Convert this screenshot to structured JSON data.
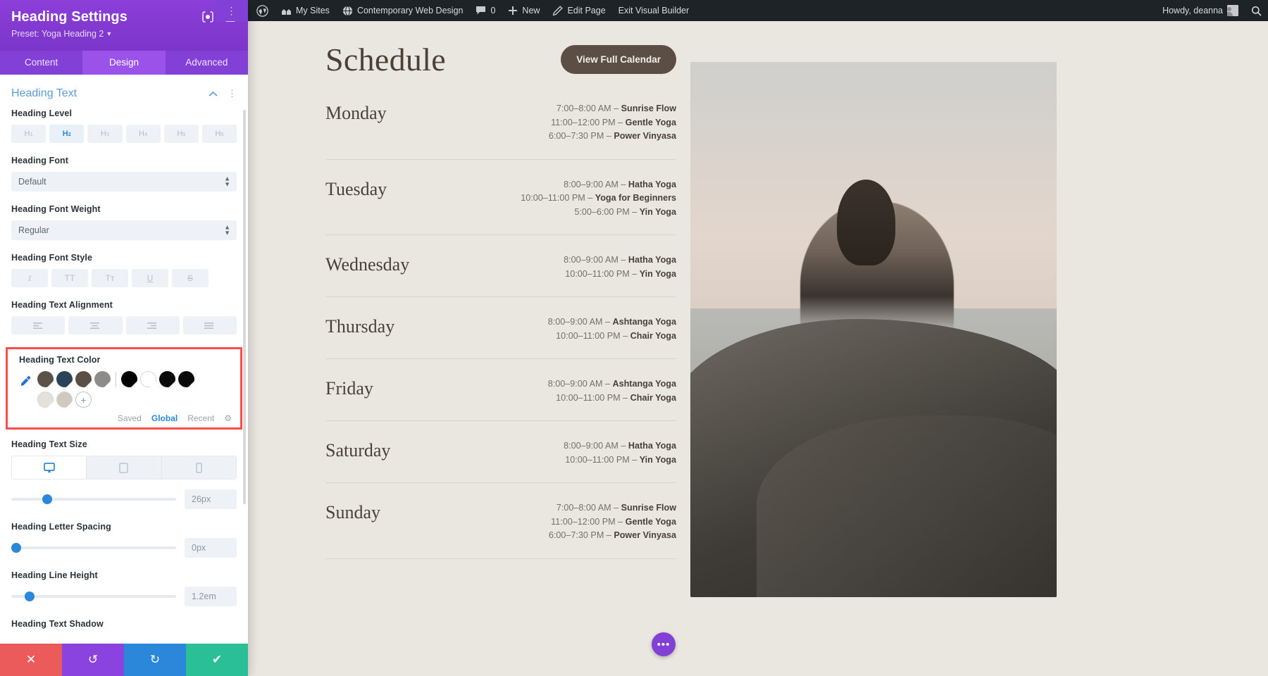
{
  "panel": {
    "title": "Heading Settings",
    "preset": "Preset: Yoga Heading 2",
    "header_icons": [
      "target-icon",
      "layout-icon",
      "more-options-icon"
    ],
    "tabs": [
      {
        "label": "Content",
        "active": false
      },
      {
        "label": "Design",
        "active": true
      },
      {
        "label": "Advanced",
        "active": false
      }
    ],
    "section": {
      "title": "Heading Text",
      "collapse_icon": "chevron-up-icon",
      "menu_icon": "kebab-menu-icon"
    },
    "fields": {
      "heading_level": {
        "label": "Heading Level",
        "options": [
          "H1",
          "H2",
          "H3",
          "H4",
          "H5",
          "H6"
        ],
        "selected": "H2"
      },
      "heading_font": {
        "label": "Heading Font",
        "value": "Default"
      },
      "heading_font_weight": {
        "label": "Heading Font Weight",
        "value": "Regular"
      },
      "heading_font_style": {
        "label": "Heading Font Style",
        "options": [
          "I",
          "TT",
          "Tт",
          "U",
          "S"
        ]
      },
      "heading_text_alignment": {
        "label": "Heading Text Alignment",
        "options": [
          "align-left",
          "align-center",
          "align-right",
          "align-justify"
        ]
      },
      "heading_text_color": {
        "label": "Heading Text Color",
        "eyedropper_icon": "eyedropper-icon",
        "swatches_row1": [
          "#5d5248",
          "#2b4258",
          "#5b4f45",
          "#8e8c8a",
          "#000000",
          "#ffffff",
          "#0a0a0a",
          "#0a0a0a"
        ],
        "swatches_row2": [
          "#e4e2d8",
          "#cfcabb"
        ],
        "add_label": "+",
        "tabs": [
          {
            "label": "Saved",
            "active": false
          },
          {
            "label": "Global",
            "active": true
          },
          {
            "label": "Recent",
            "active": false
          }
        ],
        "settings_icon": "gear-icon"
      },
      "heading_text_size": {
        "label": "Heading Text Size",
        "devices": [
          "desktop-icon",
          "tablet-icon",
          "phone-icon"
        ],
        "active_device": "desktop-icon",
        "value": "26px",
        "slider_percent": 19
      },
      "heading_letter_spacing": {
        "label": "Heading Letter Spacing",
        "value": "0px",
        "slider_percent": 0
      },
      "heading_line_height": {
        "label": "Heading Line Height",
        "value": "1.2em",
        "slider_percent": 8
      },
      "heading_text_shadow": {
        "label": "Heading Text Shadow"
      }
    },
    "footer": {
      "cancel": "✕",
      "undo": "↺",
      "redo": "↻",
      "save": "✔"
    }
  },
  "adminbar": {
    "left_items": [
      {
        "label": "",
        "icon": "wordpress-logo-icon"
      },
      {
        "label": "My Sites",
        "icon": "sites-icon"
      },
      {
        "label": "Contemporary Web Design",
        "icon": "site-icon"
      },
      {
        "label": "0",
        "icon": "comment-icon"
      },
      {
        "label": "New",
        "icon": "plus-icon"
      },
      {
        "label": "Edit Page",
        "icon": "pencil-icon"
      },
      {
        "label": "Exit Visual Builder",
        "icon": ""
      }
    ],
    "howdy": "Howdy, deanna",
    "avatar": "avatar-icon",
    "search_icon": "search-icon"
  },
  "page": {
    "heading": "Schedule",
    "cta": "View Full Calendar",
    "fab_icon": "more-dots-icon",
    "days": [
      {
        "name": "Monday",
        "classes": [
          {
            "time": "7:00–8:00 AM",
            "name": "Sunrise Flow"
          },
          {
            "time": "11:00–12:00 PM",
            "name": "Gentle Yoga"
          },
          {
            "time": "6:00–7:30 PM",
            "name": "Power Vinyasa"
          }
        ]
      },
      {
        "name": "Tuesday",
        "classes": [
          {
            "time": "8:00–9:00 AM",
            "name": "Hatha Yoga"
          },
          {
            "time": "10:00–11:00 PM",
            "name": "Yoga for Beginners"
          },
          {
            "time": "5:00–6:00 PM",
            "name": "Yin Yoga"
          }
        ]
      },
      {
        "name": "Wednesday",
        "classes": [
          {
            "time": "8:00–9:00 AM",
            "name": "Hatha Yoga"
          },
          {
            "time": "10:00–11:00 PM",
            "name": "Yin Yoga"
          }
        ]
      },
      {
        "name": "Thursday",
        "classes": [
          {
            "time": "8:00–9:00 AM",
            "name": "Ashtanga Yoga"
          },
          {
            "time": "10:00–11:00 PM",
            "name": "Chair Yoga"
          }
        ]
      },
      {
        "name": "Friday",
        "classes": [
          {
            "time": "8:00–9:00 AM",
            "name": "Ashtanga Yoga"
          },
          {
            "time": "10:00–11:00 PM",
            "name": "Chair Yoga"
          }
        ]
      },
      {
        "name": "Saturday",
        "classes": [
          {
            "time": "8:00–9:00 AM",
            "name": "Hatha Yoga"
          },
          {
            "time": "10:00–11:00 PM",
            "name": "Yin Yoga"
          }
        ]
      },
      {
        "name": "Sunday",
        "classes": [
          {
            "time": "7:00–8:00 AM",
            "name": "Sunrise Flow"
          },
          {
            "time": "11:00–12:00 PM",
            "name": "Gentle Yoga"
          },
          {
            "time": "6:00–7:30 PM",
            "name": "Power Vinyasa"
          }
        ]
      }
    ],
    "photo_alt": "woman-meditating-on-rock-photo"
  },
  "colors": {
    "panel_purple": "#8340d6",
    "accent_blue": "#2b87da",
    "highlight_red": "#ff4d4d",
    "canvas_bg": "#eae7e0",
    "heading_brown": "#4a4239"
  }
}
